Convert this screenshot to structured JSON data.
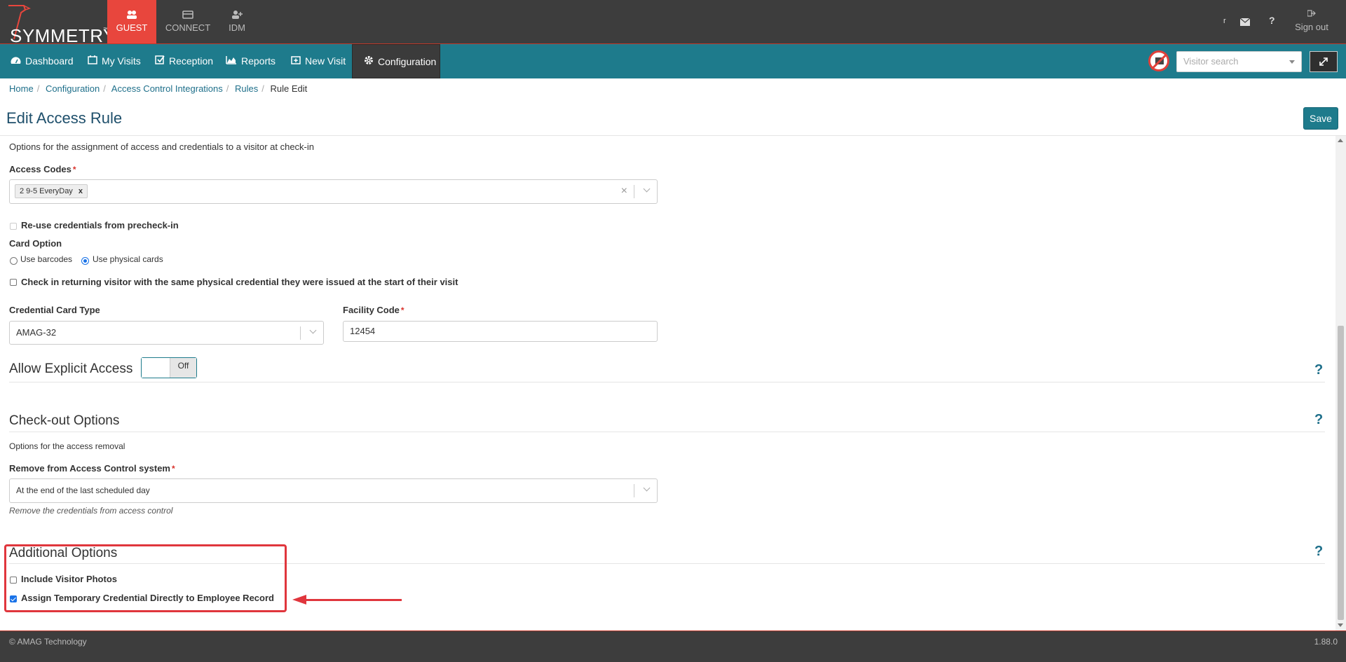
{
  "app": {
    "logo_text": "SYMMETRY",
    "logo_tm": "™",
    "tabs": [
      {
        "label": "GUEST"
      },
      {
        "label": "CONNECT"
      },
      {
        "label": "IDM"
      }
    ],
    "top_icons": [
      "user-icon",
      "mail-icon",
      "help-icon"
    ],
    "user_initial": "r",
    "help_glyph": "?",
    "signout_label": "Sign out"
  },
  "nav": {
    "items": [
      {
        "label": "Dashboard",
        "icon": "dashboard-icon"
      },
      {
        "label": "My Visits",
        "icon": "calendar-icon"
      },
      {
        "label": "Reception",
        "icon": "checkbox-icon"
      },
      {
        "label": "Reports",
        "icon": "chart-icon"
      },
      {
        "label": "New Visit",
        "icon": "calendar-plus-icon"
      },
      {
        "label": "Configuration",
        "icon": "gear-icon",
        "active": true
      }
    ],
    "visitor_search_placeholder": "Visitor search"
  },
  "breadcrumb": [
    "Home",
    "Configuration",
    "Access Control Integrations",
    "Rules",
    "Rule Edit"
  ],
  "page": {
    "title": "Edit Access Rule",
    "save_label": "Save"
  },
  "checkin": {
    "description": "Options for the assignment of access and credentials to a visitor at check-in",
    "access_codes_label": "Access Codes",
    "access_codes_selected": "2 9-5 EveryDay",
    "chip_remove": "x",
    "clear_glyph": "×",
    "required_mark": "*",
    "reuse_label": "Re-use credentials from precheck-in",
    "card_option_label": "Card Option",
    "card_options": [
      {
        "label": "Use barcodes",
        "checked": false
      },
      {
        "label": "Use physical cards",
        "checked": true
      }
    ],
    "returning_label": "Check in returning visitor with the same physical credential they were issued at the start of their visit",
    "credential_type_label": "Credential Card Type",
    "credential_type_value": "AMAG-32",
    "facility_code_label": "Facility Code",
    "facility_code_value": "12454"
  },
  "explicit_access": {
    "title": "Allow Explicit Access",
    "toggle_label": "Off"
  },
  "checkout": {
    "title": "Check-out Options",
    "description": "Options for the access removal",
    "remove_label": "Remove from Access Control system",
    "remove_value": "At the end of the last scheduled day",
    "remove_note": "Remove the credentials from access control"
  },
  "additional": {
    "title": "Additional Options",
    "include_photos_label": "Include Visitor Photos",
    "include_photos_checked": false,
    "assign_temp_label": "Assign Temporary Credential Directly to Employee Record",
    "assign_temp_checked": true
  },
  "footer": {
    "copyright": "© AMAG Technology",
    "version": "1.88.0"
  },
  "colors": {
    "accent": "#1e7b8c",
    "guest_tab": "#e8463d",
    "annotation": "#e0363d"
  }
}
